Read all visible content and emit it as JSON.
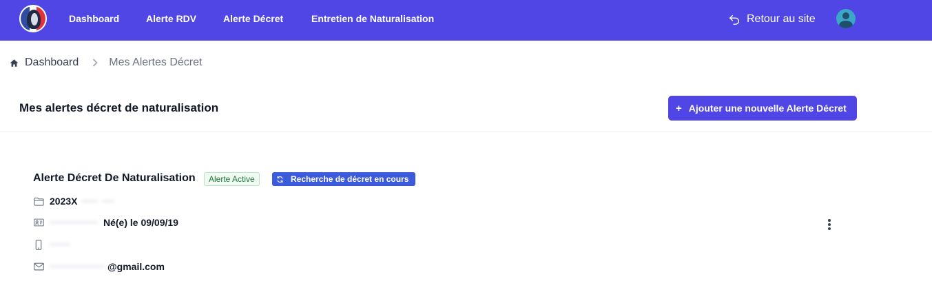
{
  "nav": {
    "items": [
      {
        "label": "Dashboard"
      },
      {
        "label": "Alerte RDV"
      },
      {
        "label": "Alerte Décret"
      },
      {
        "label": "Entretien de Naturalisation"
      }
    ],
    "back_label": "Retour au site"
  },
  "breadcrumb": {
    "home": "Dashboard",
    "current": "Mes Alertes Décret"
  },
  "page": {
    "title": "Mes alertes décret de naturalisation",
    "add_button": "Ajouter une nouvelle Alerte Décret"
  },
  "alert": {
    "title": "Alerte Décret De Naturalisation",
    "status_badge": "Alerte Active",
    "search_badge": "Recherche de décret en cours",
    "dossier": "2023X",
    "identity": "Né(e) le 09/09/19",
    "email": "@gmail.com"
  },
  "colors": {
    "brand": "#4f46e5",
    "success": "#1f7a3a",
    "info": "#3b5bdb"
  }
}
